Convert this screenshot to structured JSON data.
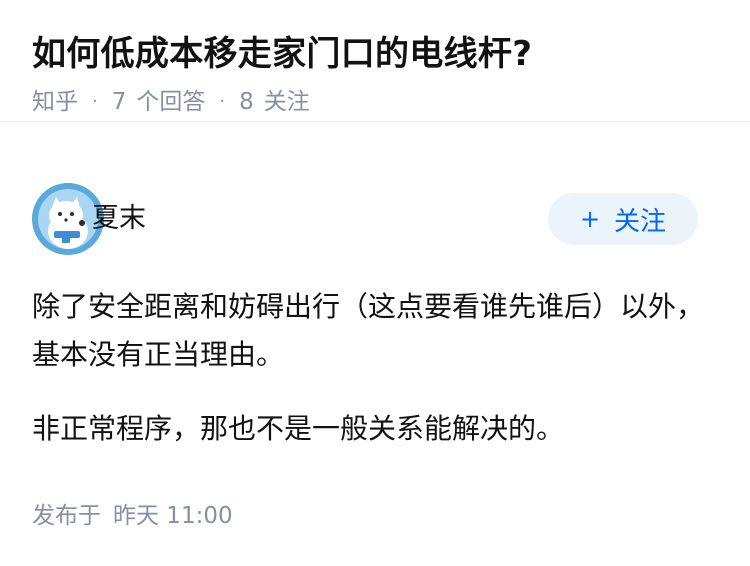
{
  "question": {
    "title": "如何低成本移走家门口的电线杆?",
    "source": "知乎",
    "separator": "·",
    "answers_count": "7",
    "answers_label": "个回答",
    "follows_count": "8",
    "follows_label": "关注"
  },
  "answer": {
    "author": {
      "name": "夏末",
      "avatar_icon": "cartoon-cat-avatar"
    },
    "follow_button": {
      "icon": "+",
      "label": "关注"
    },
    "paragraphs": [
      "除了安全距离和妨碍出行（这点要看谁先谁后）以外，基本没有正当理由。",
      "非正常程序，那也不是一般关系能解决的。"
    ],
    "publish": {
      "label": "发布于",
      "time": "昨天 11:00"
    }
  },
  "colors": {
    "text": "#121212",
    "meta": "#8590a6",
    "accent": "#0066ff",
    "button_bg": "#ebf3fb"
  }
}
